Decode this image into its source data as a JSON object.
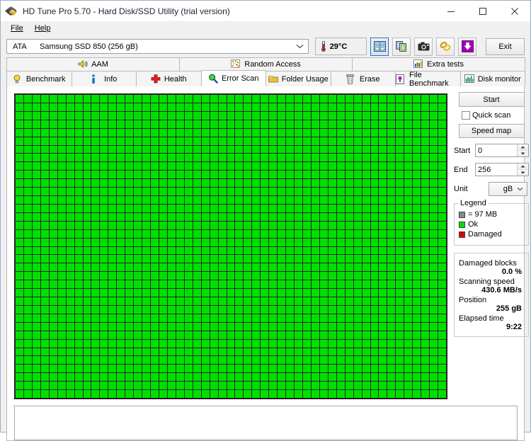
{
  "window": {
    "title": "HD Tune Pro 5.70 - Hard Disk/SSD Utility (trial version)",
    "minimize_label": "Minimize",
    "maximize_label": "Maximize",
    "close_label": "Close"
  },
  "menu": {
    "items": [
      {
        "label": "File",
        "accel": "F"
      },
      {
        "label": "Help",
        "accel": "H"
      }
    ]
  },
  "toolbar": {
    "drive_bus": "ATA",
    "drive_name": "Samsung SSD 850 (256 gB)",
    "dropdown_arrow": "⌄",
    "temperature": "29°C",
    "thermometer_icon": "thermometer-icon",
    "buttons": [
      {
        "name": "copy-info-button",
        "icon": "book-pages-icon",
        "selected": true
      },
      {
        "name": "copy-screenshot-button",
        "icon": "copy-pages-icon",
        "selected": false
      },
      {
        "name": "save-screenshot-button",
        "icon": "camera-icon",
        "selected": false
      },
      {
        "name": "link-button",
        "icon": "chain-link-icon",
        "selected": false
      },
      {
        "name": "download-button",
        "icon": "download-arrow-icon",
        "selected": false
      }
    ],
    "exit_label": "Exit"
  },
  "tabs": {
    "top_row": [
      {
        "label": "AAM",
        "icon": "speaker-icon",
        "active": false
      },
      {
        "label": "Random Access",
        "icon": "random-access-icon",
        "active": false
      },
      {
        "label": "Extra tests",
        "icon": "extra-tests-icon",
        "active": false
      }
    ],
    "bottom_row": [
      {
        "label": "Benchmark",
        "icon": "bulb-icon",
        "active": false
      },
      {
        "label": "Info",
        "icon": "info-icon",
        "active": false
      },
      {
        "label": "Health",
        "icon": "health-cross-icon",
        "active": false
      },
      {
        "label": "Error Scan",
        "icon": "magnifier-icon",
        "active": true
      },
      {
        "label": "Folder Usage",
        "icon": "folder-icon",
        "active": false
      },
      {
        "label": "Erase",
        "icon": "trash-icon",
        "active": false
      },
      {
        "label": "File Benchmark",
        "icon": "file-benchmark-icon",
        "active": false
      },
      {
        "label": "Disk monitor",
        "icon": "bar-chart-icon",
        "active": false
      }
    ]
  },
  "scan_controls": {
    "start_button": "Start",
    "quick_scan_label": "Quick scan",
    "quick_scan_checked": false,
    "speed_map_button": "Speed map",
    "range_start_label": "Start",
    "range_start_value": "0",
    "range_end_label": "End",
    "range_end_value": "256",
    "unit_label": "Unit",
    "unit_value": "gB"
  },
  "legend": {
    "title": "Legend",
    "entries": [
      {
        "label": "= 97 MB",
        "color": "#888888",
        "name": "block-size"
      },
      {
        "label": "Ok",
        "color": "#00e000",
        "name": "ok"
      },
      {
        "label": "Damaged",
        "color": "#dd0000",
        "name": "damaged"
      }
    ]
  },
  "stats": {
    "damaged_blocks_label": "Damaged blocks",
    "damaged_blocks_value": "0.0 %",
    "scanning_speed_label": "Scanning speed",
    "scanning_speed_value": "430.6 MB/s",
    "position_label": "Position",
    "position_value": "255 gB",
    "elapsed_time_label": "Elapsed time",
    "elapsed_time_value": "9:22"
  },
  "grid": {
    "columns": 51,
    "rows": 36,
    "block_size_label": "97 MB",
    "ok_color": "#00e000",
    "damaged_color": "#dd0000",
    "separator_color": "#2a2a2a",
    "total_blocks": 1836,
    "damaged_blocks": 0,
    "trailing_empty_blocks": 0
  },
  "log": {
    "text": ""
  }
}
